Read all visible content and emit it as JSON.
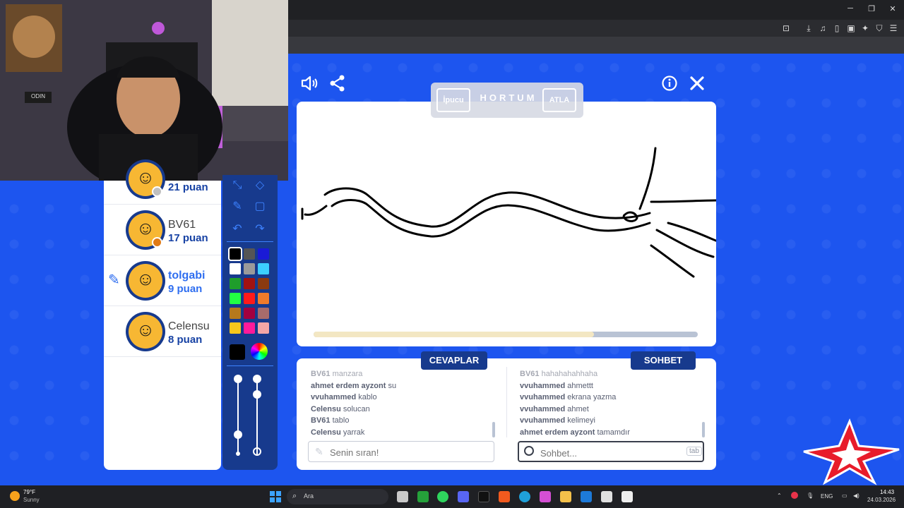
{
  "game": {
    "hint": {
      "hint_button": "İpucu",
      "word": "HORTUM",
      "skip_button": "ATLA"
    },
    "progress": 0.73,
    "players": [
      {
        "name": "",
        "score": "21 puan",
        "badge_color": "#c0c0c0"
      },
      {
        "name": "BV61",
        "score": "17 puan",
        "badge_color": "#e07a15"
      },
      {
        "name": "tolgabi",
        "score": "9 puan",
        "badge_color": ""
      },
      {
        "name": "Celensu",
        "score": "8 puan",
        "badge_color": ""
      }
    ],
    "palette": [
      [
        "#000000",
        "#555555",
        "#1a1ad6"
      ],
      [
        "#ffffff",
        "#9a9a9a",
        "#3ccfff"
      ],
      [
        "#1f9d2b",
        "#a11212",
        "#8b3a10"
      ],
      [
        "#22ff44",
        "#ff1a1a",
        "#f07b2b"
      ],
      [
        "#b6791c",
        "#a3003f",
        "#a86b6b"
      ],
      [
        "#f7c61c",
        "#ff1a9a",
        "#f4a6a6"
      ]
    ],
    "answers_tab": "CEVAPLAR",
    "chat_tab": "SOHBET",
    "answers": [
      {
        "user": "BV61",
        "text": "manzara"
      },
      {
        "user": "ahmet erdem ayzont",
        "text": "su"
      },
      {
        "user": "vvuhammed",
        "text": "kablo"
      },
      {
        "user": "Celensu",
        "text": "solucan"
      },
      {
        "user": "BV61",
        "text": "tablo"
      },
      {
        "user": "Celensu",
        "text": "yarrak"
      }
    ],
    "chat": [
      {
        "user": "BV61",
        "text": "hahahahahhaha"
      },
      {
        "user": "vvuhammed",
        "text": "ahmettt"
      },
      {
        "user": "vvuhammed",
        "text": "ekrana yazma"
      },
      {
        "user": "vvuhammed",
        "text": "ahmet"
      },
      {
        "user": "vvuhammed",
        "text": "kelimeyi"
      },
      {
        "user": "ahmet erdem ayzont",
        "text": "tamamdır"
      }
    ],
    "answer_placeholder": "Senin sıran!",
    "chat_placeholder": "Sohbet...",
    "chat_key_hint": "tab"
  },
  "webcam": {
    "sign_text": "ODIN"
  },
  "taskbar": {
    "weather_temp": "79°F",
    "weather_desc": "Sunny",
    "search_placeholder": "Ara",
    "language": "ENG",
    "time": "14:43",
    "date": "24.03.2026"
  }
}
